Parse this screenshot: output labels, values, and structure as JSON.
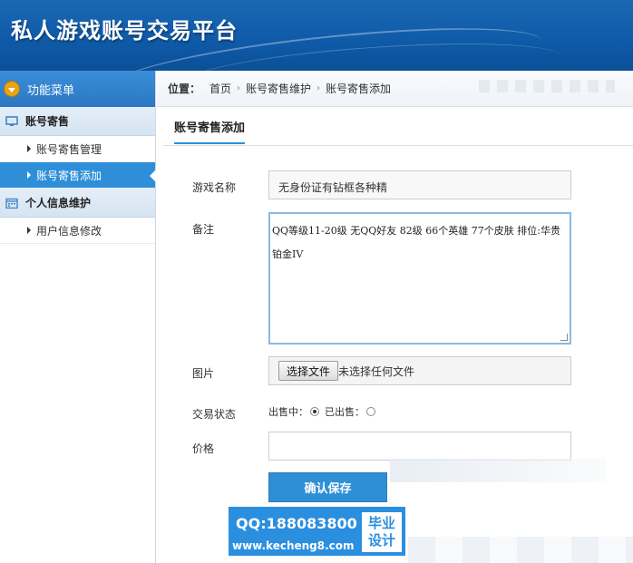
{
  "header": {
    "title": "私人游戏账号交易平台"
  },
  "sidebar": {
    "menu_title": "功能菜单",
    "groups": [
      {
        "title": "账号寄售",
        "icon": "monitor-icon",
        "items": [
          {
            "label": "账号寄售管理",
            "active": false
          },
          {
            "label": "账号寄售添加",
            "active": true
          }
        ]
      },
      {
        "title": "个人信息维护",
        "icon": "calendar-icon",
        "items": [
          {
            "label": "用户信息修改",
            "active": false
          }
        ]
      }
    ]
  },
  "breadcrumb": {
    "label": "位置：",
    "items": [
      "首页",
      "账号寄售维护",
      "账号寄售添加"
    ]
  },
  "page": {
    "tab": "账号寄售添加"
  },
  "form": {
    "game_name": {
      "label": "游戏名称",
      "value": "无身份证有钻框各种精"
    },
    "remark": {
      "label": "备注",
      "line1": " QQ等级11-20级 无QQ好友 82级 66个英雄 77个皮肤 排位:华贵",
      "line2": "铂金IV"
    },
    "image": {
      "label": "图片",
      "button": "选择文件",
      "file_text": "未选择任何文件"
    },
    "status": {
      "label": "交易状态",
      "on_sale": "出售中：",
      "sold": "已出售：",
      "selected": "on_sale"
    },
    "price": {
      "label": "价格",
      "value": ""
    },
    "save_button": "确认保存"
  },
  "watermark": {
    "qq": "QQ:188083800",
    "url": "www.kecheng8.com",
    "badge_line1": "毕业",
    "badge_line2": "设计"
  },
  "colors": {
    "header": "#1a68b4",
    "accent": "#2e8fd8",
    "button": "#2f8fd6",
    "menu_icon": "#e8a417"
  }
}
